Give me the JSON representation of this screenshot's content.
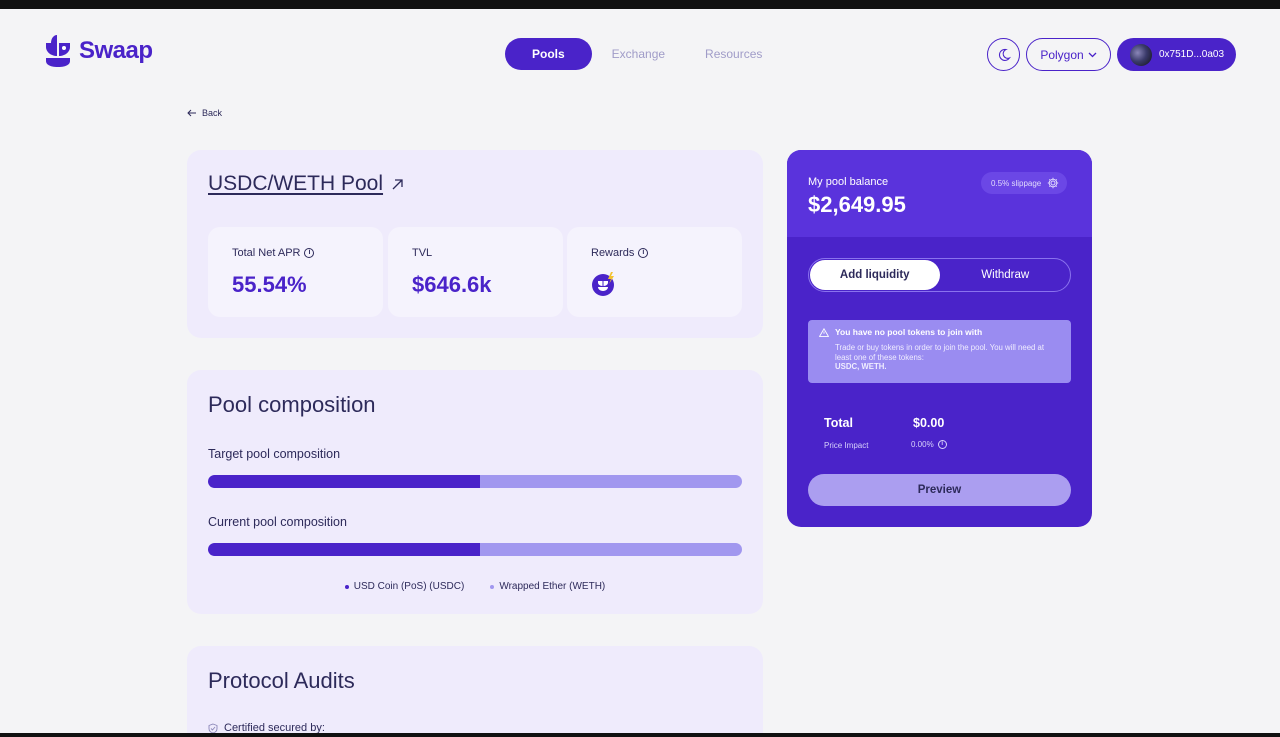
{
  "brand": {
    "name": "Swaap",
    "color": "#4a23c9"
  },
  "nav": {
    "pools": "Pools",
    "exchange": "Exchange",
    "resources": "Resources"
  },
  "header": {
    "network": "Polygon",
    "wallet": "0x751D...0a03"
  },
  "back_label": "Back",
  "pool": {
    "title": "USDC/WETH Pool",
    "stats": {
      "apr_label": "Total Net APR",
      "apr_value": "55.54%",
      "tvl_label": "TVL",
      "tvl_value": "$646.6k",
      "rewards_label": "Rewards"
    }
  },
  "composition": {
    "title": "Pool composition",
    "target_label": "Target pool composition",
    "current_label": "Current pool composition",
    "target_share_usdc": 0.51,
    "current_share_usdc": 0.51,
    "legend": [
      "USD Coin (PoS) (USDC)",
      "Wrapped Ether (WETH)"
    ],
    "colors": {
      "usdc": "#4a23c9",
      "weth": "#a197ef"
    }
  },
  "audits": {
    "title": "Protocol Audits",
    "certified": "Certified secured by:"
  },
  "panel": {
    "balance_label": "My pool balance",
    "balance_value": "$2,649.95",
    "slippage": "0.5% slippage",
    "tab_add": "Add liquidity",
    "tab_withdraw": "Withdraw",
    "alert_title": "You have no pool tokens to join with",
    "alert_body": "Trade or buy tokens in order to join the pool. You will need at least one of these tokens:",
    "alert_tokens": "USDC, WETH.",
    "total_label": "Total",
    "total_value": "$0.00",
    "impact_label": "Price Impact",
    "impact_value": "0.00%",
    "preview": "Preview"
  }
}
